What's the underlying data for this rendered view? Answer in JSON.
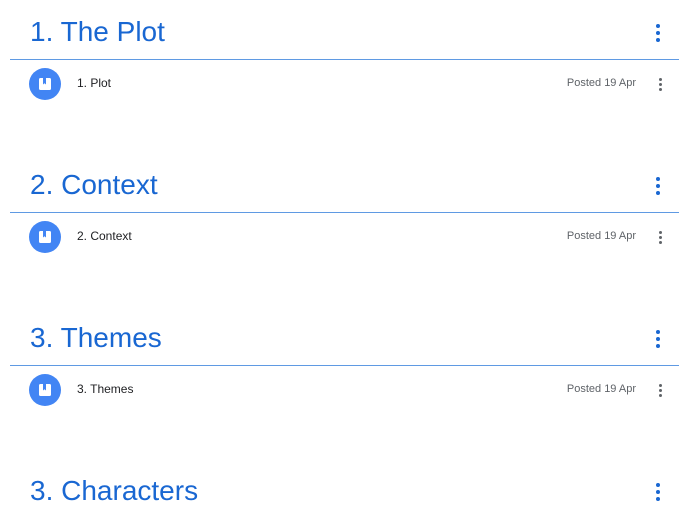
{
  "topics": [
    {
      "title": "1. The Plot",
      "material": {
        "title": "1. Plot",
        "date": "Posted 19 Apr",
        "icon": "material-icon"
      }
    },
    {
      "title": "2. Context",
      "material": {
        "title": "2. Context",
        "date": "Posted 19 Apr",
        "icon": "material-icon"
      }
    },
    {
      "title": "3. Themes",
      "material": {
        "title": "3. Themes",
        "date": "Posted 19 Apr",
        "icon": "material-icon"
      }
    },
    {
      "title": "3. Characters"
    }
  ],
  "colors": {
    "topic_title": "#1967d2",
    "divider": "#5f9ae3",
    "icon_circle": "#4285f4",
    "date_text": "#5f6368"
  }
}
